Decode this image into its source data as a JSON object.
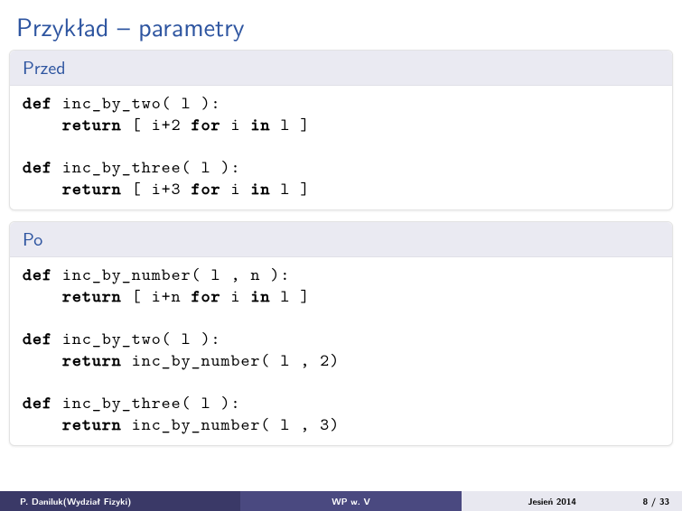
{
  "title": "Przykład – parametry",
  "block1": {
    "header": "Przed",
    "code": [
      {
        "t": "kw",
        "s": "def"
      },
      {
        "t": "tx",
        "s": " inc_by_two( l ):"
      },
      {
        "t": "br"
      },
      {
        "t": "tx",
        "s": "    "
      },
      {
        "t": "kw",
        "s": "return"
      },
      {
        "t": "tx",
        "s": " [ i+2 "
      },
      {
        "t": "kw",
        "s": "for"
      },
      {
        "t": "tx",
        "s": " i "
      },
      {
        "t": "kw",
        "s": "in"
      },
      {
        "t": "tx",
        "s": " l ]"
      },
      {
        "t": "br"
      },
      {
        "t": "br"
      },
      {
        "t": "kw",
        "s": "def"
      },
      {
        "t": "tx",
        "s": " inc_by_three( l ):"
      },
      {
        "t": "br"
      },
      {
        "t": "tx",
        "s": "    "
      },
      {
        "t": "kw",
        "s": "return"
      },
      {
        "t": "tx",
        "s": " [ i+3 "
      },
      {
        "t": "kw",
        "s": "for"
      },
      {
        "t": "tx",
        "s": " i "
      },
      {
        "t": "kw",
        "s": "in"
      },
      {
        "t": "tx",
        "s": " l ]"
      }
    ]
  },
  "block2": {
    "header": "Po",
    "code": [
      {
        "t": "kw",
        "s": "def"
      },
      {
        "t": "tx",
        "s": " inc_by_number( l , n ):"
      },
      {
        "t": "br"
      },
      {
        "t": "tx",
        "s": "    "
      },
      {
        "t": "kw",
        "s": "return"
      },
      {
        "t": "tx",
        "s": " [ i+n "
      },
      {
        "t": "kw",
        "s": "for"
      },
      {
        "t": "tx",
        "s": " i "
      },
      {
        "t": "kw",
        "s": "in"
      },
      {
        "t": "tx",
        "s": " l ]"
      },
      {
        "t": "br"
      },
      {
        "t": "br"
      },
      {
        "t": "kw",
        "s": "def"
      },
      {
        "t": "tx",
        "s": " inc_by_two( l ):"
      },
      {
        "t": "br"
      },
      {
        "t": "tx",
        "s": "    "
      },
      {
        "t": "kw",
        "s": "return"
      },
      {
        "t": "tx",
        "s": " inc_by_number( l , 2)"
      },
      {
        "t": "br"
      },
      {
        "t": "br"
      },
      {
        "t": "kw",
        "s": "def"
      },
      {
        "t": "tx",
        "s": " inc_by_three( l ):"
      },
      {
        "t": "br"
      },
      {
        "t": "tx",
        "s": "    "
      },
      {
        "t": "kw",
        "s": "return"
      },
      {
        "t": "tx",
        "s": " inc_by_number( l , 3)"
      }
    ]
  },
  "footer": {
    "author": "P. Daniluk(Wydział Fizyki)",
    "center": "WP w. V",
    "date": "Jesień 2014",
    "page": "8 / 33"
  }
}
